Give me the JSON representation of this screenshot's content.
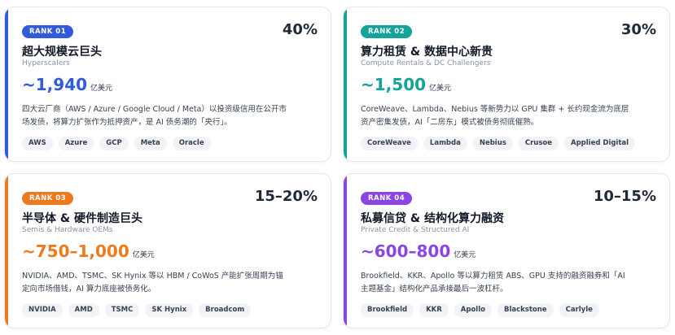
{
  "cards": [
    {
      "rank": "RANK 01",
      "share": "40%",
      "title": "超大规模云巨头",
      "subtitle": "Hyperscalers",
      "amount": "~1,940",
      "unit": "亿美元",
      "desc_line1": "四大云厂商（AWS / Azure / Google Cloud / Meta）以投资级信用在公开市",
      "desc_line2": "场发债，将算力扩张作为抵押资产，是 AI 债务潮的「央行」。",
      "tags": [
        "AWS",
        "Azure",
        "GCP",
        "Meta",
        "Oracle"
      ],
      "color": "#2f5bdc"
    },
    {
      "rank": "RANK 02",
      "share": "30%",
      "title": "算力租赁 & 数据中心新贵",
      "subtitle": "Compute Rentals & DC Challengers",
      "amount": "~1,500",
      "unit": "亿美元",
      "desc_line1": "CoreWeave、Lambda、Nebius 等新势力以 GPU 集群 + 长约现金流为底层",
      "desc_line2": "资产密集发债，AI「二房东」模式被债务彻底催熟。",
      "tags": [
        "CoreWeave",
        "Lambda",
        "Nebius",
        "Crusoe",
        "Applied Digital"
      ],
      "color": "#13a39b"
    },
    {
      "rank": "RANK 03",
      "share": "15–20%",
      "title": "半导体 & 硬件制造巨头",
      "subtitle": "Semis & Hardware OEMs",
      "amount": "~750–1,000",
      "unit": "亿美元",
      "desc_line1": "NVIDIA、AMD、TSMC、SK Hynix 等以 HBM / CoWoS 产能扩张周期为锚",
      "desc_line2": "定向市场借钱，AI 算力底座被债务化。",
      "tags": [
        "NVIDIA",
        "AMD",
        "TSMC",
        "SK Hynix",
        "Broadcom"
      ],
      "color": "#ee7a1e"
    },
    {
      "rank": "RANK 04",
      "share": "10–15%",
      "title": "私募信贷 & 结构化算力融资",
      "subtitle": "Private Credit & Structured AI",
      "amount": "~600–800",
      "unit": "亿美元",
      "desc_line1": "Brookfield、KKR、Apollo 等以算力租赁 ABS、GPU 支持的融资融券和「AI",
      "desc_line2": "主题基金」结构化产品承接最后一波杠杆。",
      "tags": [
        "Brookfield",
        "KKR",
        "Apollo",
        "Blackstone",
        "Carlyle"
      ],
      "color": "#8b45e0"
    }
  ]
}
